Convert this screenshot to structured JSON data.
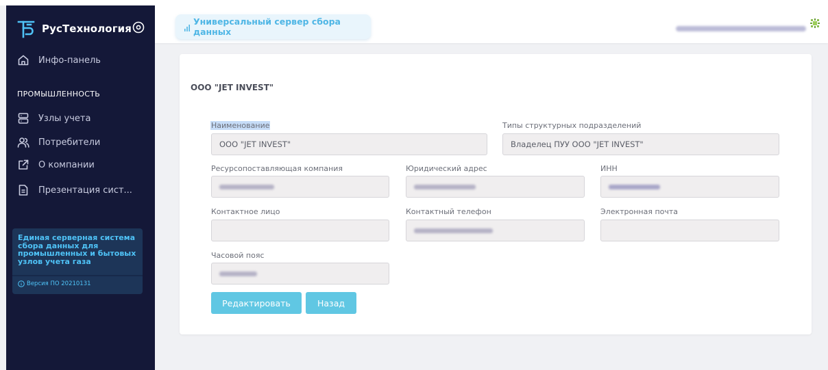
{
  "sidebar": {
    "brand": "РусТехнология",
    "items": [
      {
        "label": "Инфо-панель",
        "icon": "home-icon"
      },
      {
        "label": "Узлы учета",
        "icon": "server-icon"
      },
      {
        "label": "Потребители",
        "icon": "users-icon"
      },
      {
        "label": "О компании",
        "icon": "external-link-icon"
      },
      {
        "label": "Презентация сист...",
        "icon": "document-icon"
      }
    ],
    "section_title": "ПРОМЫШЛЕННОСТЬ",
    "info_text": "Единая серверная система сбора данных для промышленных и бытовых узлов учета газа",
    "version": "Версия ПО 20210131"
  },
  "header": {
    "app_title": "Универсальный сервер сбора данных"
  },
  "company": {
    "title": "ООО \"JET INVEST\"",
    "fields": {
      "name_label": "Наименование",
      "name_value": "ООО \"JET INVEST\"",
      "unit_types_label": "Типы структурных подразделений",
      "unit_types_value": "Владелец ПУУ ООО \"JET INVEST\"",
      "supplier_label": "Ресурсопоставляющая компания",
      "address_label": "Юридический адрес",
      "inn_label": "ИНН",
      "contact_label": "Контактное лицо",
      "phone_label": "Контактный телефон",
      "email_label": "Электронная почта",
      "timezone_label": "Часовой пояс"
    },
    "buttons": {
      "edit": "Редактировать",
      "back": "Назад"
    }
  },
  "colors": {
    "sidebar_bg": "#141838",
    "accent": "#4fc3f7",
    "button": "#60c7e3"
  }
}
